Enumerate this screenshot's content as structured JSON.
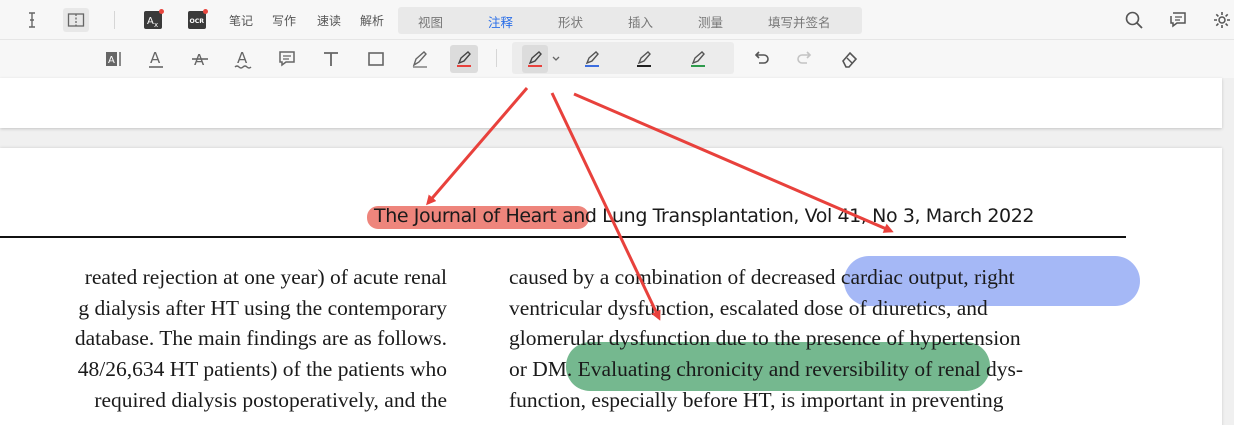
{
  "toolbar": {
    "note": "笔记",
    "write": "写作",
    "speed_read": "速读",
    "analyze": "解析",
    "tabs": [
      "视图",
      "注释",
      "形状",
      "插入",
      "测量",
      "填写并签名"
    ],
    "active_tab": "注释"
  },
  "document": {
    "running_header": "The Journal of Heart and Lung Transplantation, Vol 41, No 3, March 2022",
    "left_column": [
      "reated rejection at one year) of acute renal",
      "g dialysis after HT using the contemporary",
      "database. The main findings are as follows.",
      "48/26,634 HT patients) of the patients who",
      "required dialysis postoperatively, and the"
    ],
    "right_column": [
      "caused by a combination of decreased cardiac output, right",
      "ventricular dysfunction, escalated dose of diuretics, and",
      "glomerular dysfunction due to the presence of hypertension",
      "or DM. Evaluating chronicity and reversibility of renal dys-",
      "function, especially before HT, is important in preventing"
    ]
  },
  "colors": {
    "accent": "#2b6fe8",
    "highlight_red": "#e85c50",
    "highlight_blue": "#6e8cf0",
    "highlight_green": "#34965a",
    "arrow": "#e8413c"
  },
  "icons": {
    "top": [
      "text-cursor-icon",
      "split-view-icon",
      "translate-icon",
      "ocr-icon"
    ],
    "right": [
      "search-icon",
      "comment-icon",
      "settings-icon"
    ],
    "annotation": [
      "text-box-icon",
      "underline-icon",
      "strikethrough-icon",
      "squiggly-underline-icon",
      "note-icon",
      "text-icon",
      "rectangle-icon",
      "pencil-icon",
      "highlighter-icon",
      "undo-icon",
      "redo-icon",
      "eraser-icon"
    ]
  }
}
